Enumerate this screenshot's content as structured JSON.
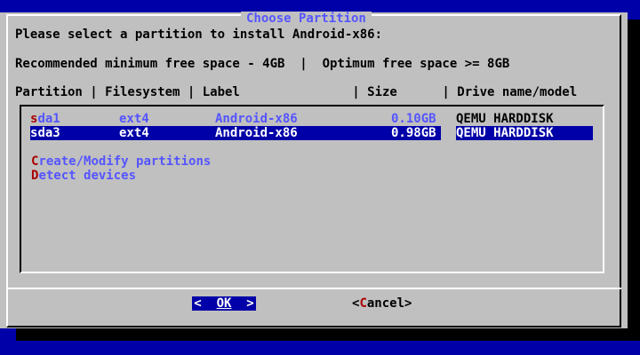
{
  "dialog": {
    "title": "Choose Partition",
    "prompt": "Please select a partition to install Android-x86:",
    "space_note": "Recommended minimum free space - 4GB  |  Optimum free space >= 8GB",
    "header": "Partition | Filesystem | Label               | Size      | Drive name/model"
  },
  "partitions": [
    {
      "hot": "s",
      "name_rest": "da1",
      "filesystem": "ext4",
      "label": "Android-x86",
      "size": "0.10GB",
      "drive": "QEMU HARDDISK",
      "selected": false
    },
    {
      "hot": "s",
      "name_rest": "da3",
      "filesystem": "ext4",
      "label": "Android-x86",
      "size": "0.98GB",
      "drive": "QEMU HARDDISK",
      "selected": true
    }
  ],
  "actions": [
    {
      "hot": "C",
      "rest": "reate/Modify partitions"
    },
    {
      "hot": "D",
      "rest": "etect devices"
    }
  ],
  "buttons": {
    "ok_left": "<",
    "ok_label": "OK",
    "ok_right": ">",
    "cancel_left": "<",
    "cancel_hot": "C",
    "cancel_rest": "ancel",
    "cancel_right": ">"
  },
  "colors": {
    "background": "#0000a8",
    "dialog": "#c0c0c0",
    "title": "#5555ff",
    "hotkey": "#aa0000",
    "selection": "#0000a8"
  }
}
